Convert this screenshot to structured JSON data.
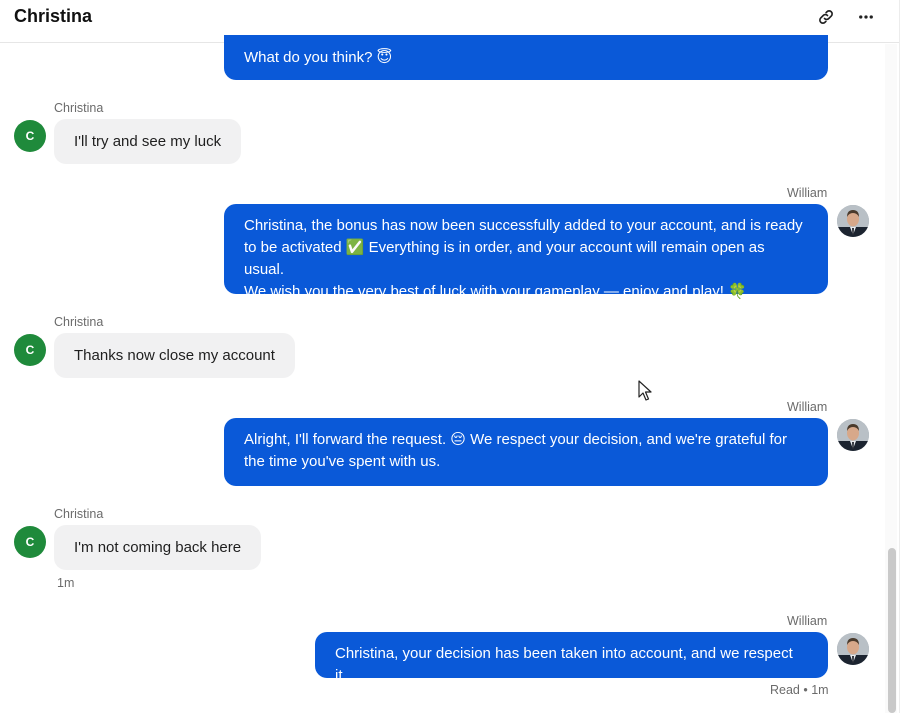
{
  "header": {
    "title": "Christina",
    "link_icon": "link-icon",
    "more_icon": "more-horizontal-icon"
  },
  "colors": {
    "outgoing_bubble": "#0a59d8",
    "incoming_bubble": "#f1f1f2",
    "customer_avatar": "#1f8a3b"
  },
  "messages": [
    {
      "direction": "outgoing",
      "text": "What do you think? 😇"
    },
    {
      "direction": "incoming",
      "sender": "Christina",
      "avatar_initial": "C",
      "text": "I'll try and see my luck"
    },
    {
      "direction": "outgoing",
      "sender": "William",
      "lines": [
        "Christina, the bonus has now been successfully added to your account, and is ready",
        "to be activated ✅ Everything is in order, and your account will remain open as usual.",
        "We wish you the very best of luck with your gameplay — enjoy and play! 🍀"
      ]
    },
    {
      "direction": "incoming",
      "sender": "Christina",
      "avatar_initial": "C",
      "text": "Thanks now close my account"
    },
    {
      "direction": "outgoing",
      "sender": "William",
      "lines": [
        "Alright, I'll forward the request. 😔 We respect your decision, and we're grateful for",
        "the time you've spent with us."
      ]
    },
    {
      "direction": "incoming",
      "sender": "Christina",
      "avatar_initial": "C",
      "text": "I'm not coming back here",
      "time": "1m"
    },
    {
      "direction": "outgoing",
      "sender": "William",
      "text": "Christina, your decision has been taken into account, and we respect it.",
      "status": "Read • 1m"
    }
  ]
}
